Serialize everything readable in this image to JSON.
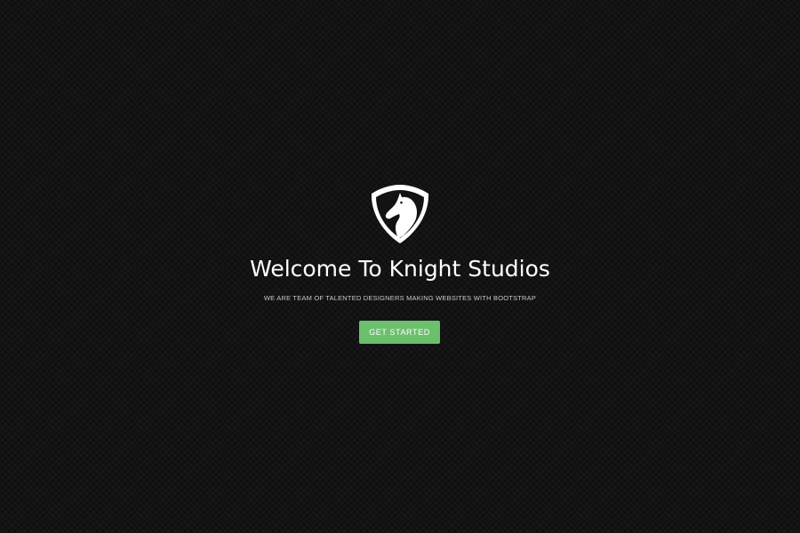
{
  "hero": {
    "logo_icon": "knight-shield-icon",
    "title": "Welcome To Knight Studios",
    "subtitle": "WE ARE TEAM OF TALENTED DESIGNERS MAKING WEBSITES WITH BOOTSTRAP",
    "cta_label": "GET STARTED"
  },
  "colors": {
    "background": "#131313",
    "text": "#ffffff",
    "subtitle_text": "#c8c8c8",
    "cta_background": "#6cbf6c"
  }
}
